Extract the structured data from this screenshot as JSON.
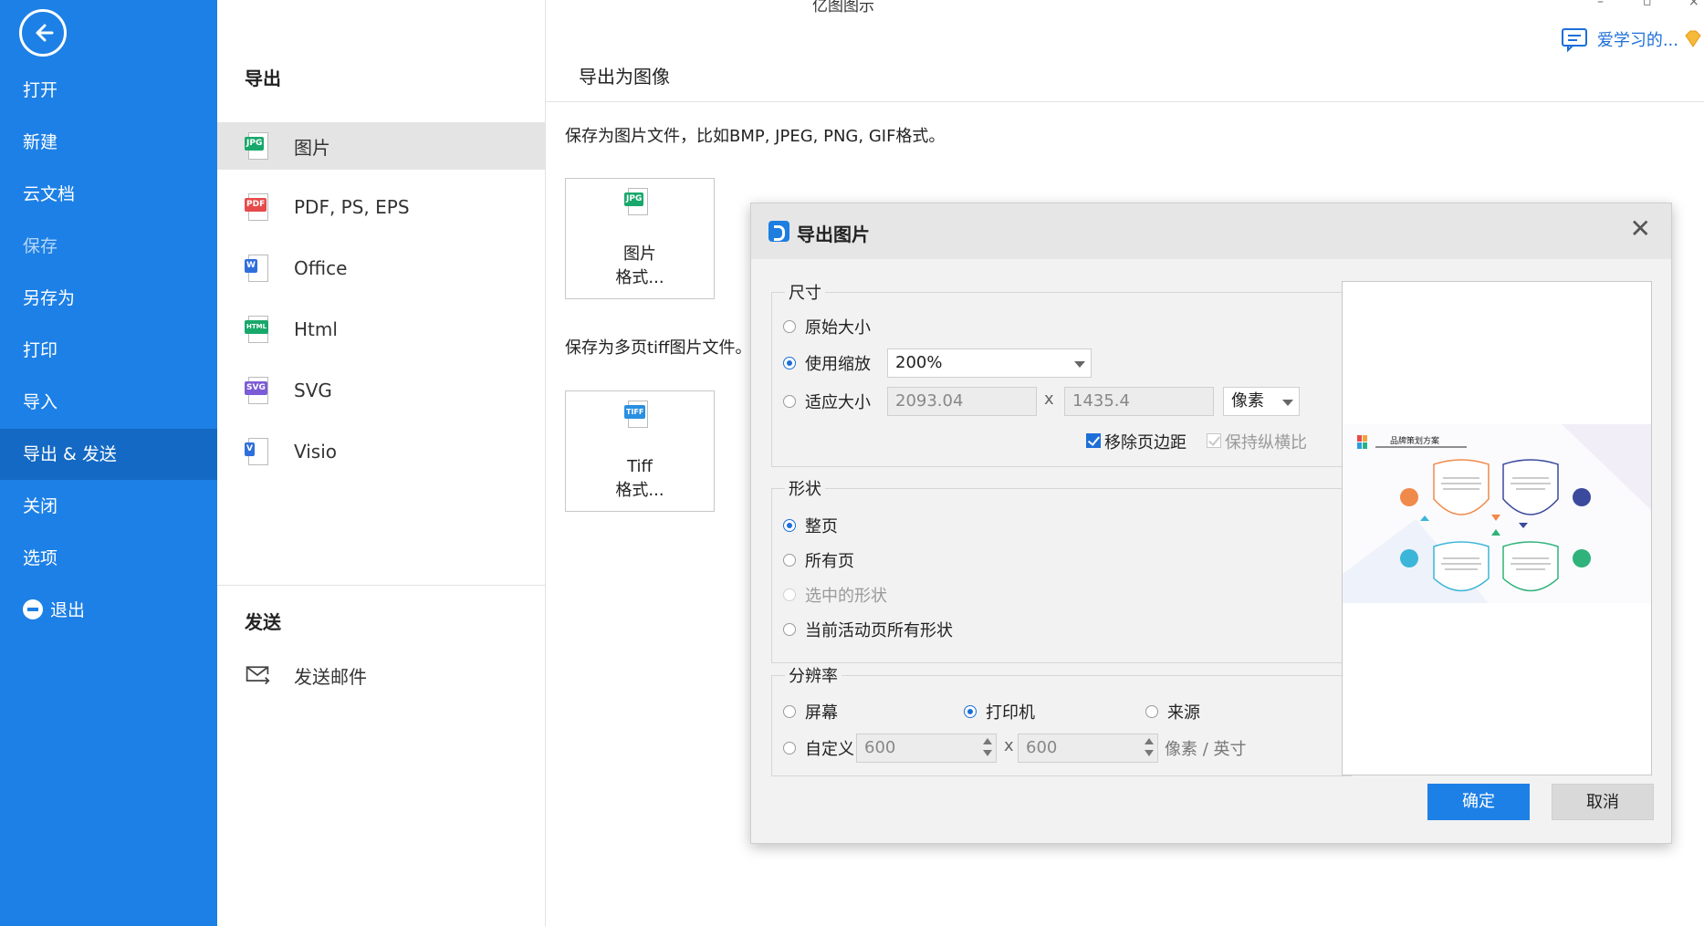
{
  "app": {
    "title": "亿图图示",
    "minimize": "–",
    "restore": "▫",
    "close": "×",
    "user_name": "爱学习的..."
  },
  "sidebar": {
    "items": [
      {
        "label": "打开"
      },
      {
        "label": "新建"
      },
      {
        "label": "云文档"
      },
      {
        "label": "保存"
      },
      {
        "label": "另存为"
      },
      {
        "label": "打印"
      },
      {
        "label": "导入"
      },
      {
        "label": "导出 & 发送"
      },
      {
        "label": "关闭"
      },
      {
        "label": "选项"
      },
      {
        "label": "退出"
      }
    ],
    "active_index": 7
  },
  "export_panel": {
    "title": "导出",
    "items": [
      {
        "label": "图片",
        "badge": "JPG",
        "color": "#19a86b"
      },
      {
        "label": "PDF, PS, EPS",
        "badge": "PDF",
        "color": "#e64b4b"
      },
      {
        "label": "Office",
        "badge": "W",
        "color": "#2f6fdb"
      },
      {
        "label": "Html",
        "badge": "HTML",
        "color": "#19a86b"
      },
      {
        "label": "SVG",
        "badge": "SVG",
        "color": "#7b5cd6"
      },
      {
        "label": "Visio",
        "badge": "V",
        "color": "#2f6fdb"
      }
    ],
    "send_title": "发送",
    "send_items": [
      {
        "label": "发送邮件"
      }
    ]
  },
  "content": {
    "title": "导出为图像",
    "desc1": "保存为图片文件，比如BMP, JPEG, PNG, GIF格式。",
    "tile1": {
      "badge": "JPG",
      "line1": "图片",
      "line2": "格式..."
    },
    "desc2": "保存为多页tiff图片文件。",
    "tile2": {
      "badge": "TIFF",
      "line1": "Tiff",
      "line2": "格式..."
    }
  },
  "dialog": {
    "title": "导出图片",
    "size_group": {
      "title": "尺寸",
      "original": "原始大小",
      "use_zoom": "使用缩放",
      "zoom_value": "200%",
      "fit_size": "适应大小",
      "width": "2093.04",
      "x": "x",
      "height": "1435.4",
      "unit": "像素",
      "remove_margin": "移除页边距",
      "keep_ratio": "保持纵横比"
    },
    "shape_group": {
      "title": "形状",
      "whole_page": "整页",
      "all_pages": "所有页",
      "selected": "选中的形状",
      "current_page_all": "当前活动页所有形状"
    },
    "resolution_group": {
      "title": "分辨率",
      "screen": "屏幕",
      "printer": "打印机",
      "source": "来源",
      "custom": "自定义",
      "res_x": "600",
      "x": "x",
      "res_y": "600",
      "unit": "像素 / 英寸"
    },
    "preview": {
      "diagram_title": "品牌策划方案"
    },
    "ok": "确定",
    "cancel": "取消"
  }
}
